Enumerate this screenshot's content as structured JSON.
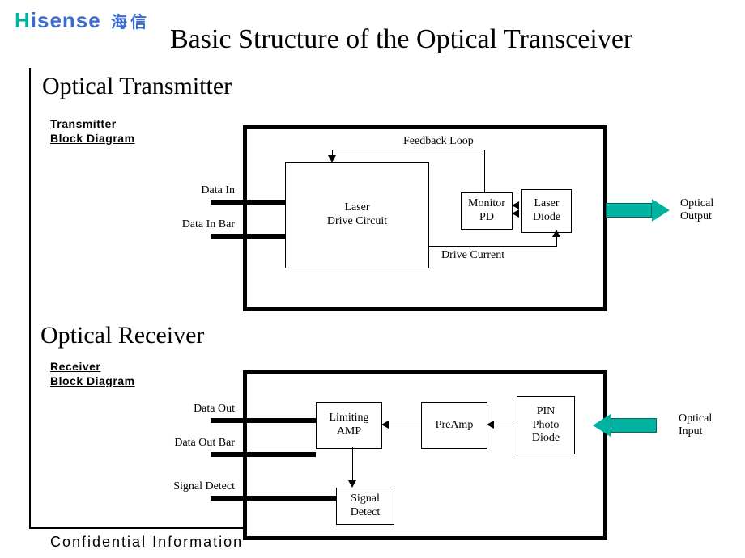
{
  "logo": {
    "h": "H",
    "isense": "isense",
    "cn": "海信"
  },
  "title": "Basic Structure of the Optical Transceiver",
  "confidential": "Confidential   Information",
  "transmitter": {
    "section_title": "Optical Transmitter",
    "sub_title": "Transmitter ",
    "sub_title2": "Block Diagram",
    "signals": {
      "data_in": "Data In",
      "data_in_bar": "Data In Bar"
    },
    "blocks": {
      "drive": "Laser\nDrive Circuit",
      "monitor": "Monitor\nPD",
      "laser": "Laser\nDiode"
    },
    "wires": {
      "feedback": "Feedback Loop",
      "drive_current": "Drive Current"
    },
    "output": "Optical\nOutput"
  },
  "receiver": {
    "section_title": "Optical Receiver",
    "sub_title": "Receiver ",
    "sub_title2": "Block Diagram",
    "signals": {
      "data_out": "Data Out",
      "data_out_bar": "Data Out Bar",
      "signal_detect": "Signal Detect"
    },
    "blocks": {
      "limiting": "Limiting\nAMP",
      "preamp": "PreAmp",
      "pin": "PIN\nPhoto\nDiode",
      "sig_detect": "Signal\nDetect"
    },
    "input": "Optical\nInput"
  }
}
